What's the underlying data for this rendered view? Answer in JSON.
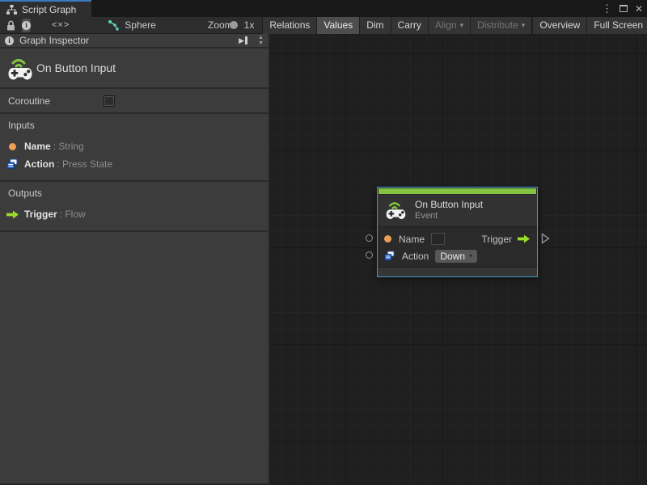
{
  "window": {
    "tab_label": "Script Graph"
  },
  "icons": {
    "menu": "⋮",
    "close": "✕",
    "code": "<×>",
    "dropdown": "▾",
    "caret": "▾",
    "spin_up": "▲",
    "spin_down": "▼",
    "info": "i",
    "dock_triangle": "▶"
  },
  "toolbar": {
    "graph_name": "Sphere",
    "zoom_label": "Zoom",
    "zoom_value": "1x",
    "buttons": [
      {
        "label": "Relations",
        "state": "normal"
      },
      {
        "label": "Values",
        "state": "active"
      },
      {
        "label": "Dim",
        "state": "normal"
      },
      {
        "label": "Carry",
        "state": "normal"
      },
      {
        "label": "Align",
        "state": "disabled",
        "dropdown": true
      },
      {
        "label": "Distribute",
        "state": "disabled",
        "dropdown": true
      },
      {
        "label": "Overview",
        "state": "normal"
      },
      {
        "label": "Full Screen",
        "state": "normal"
      }
    ]
  },
  "inspector": {
    "title": "Graph Inspector",
    "unit_title": "On Button Input",
    "coroutine_label": "Coroutine",
    "coroutine_checked": false,
    "inputs_title": "Inputs",
    "inputs": [
      {
        "name": "Name",
        "type": ": String",
        "icon": "string-port"
      },
      {
        "name": "Action",
        "type": ": Press State",
        "icon": "enum-port"
      }
    ],
    "outputs_title": "Outputs",
    "outputs": [
      {
        "name": "Trigger",
        "type": ": Flow",
        "icon": "flow-port"
      }
    ]
  },
  "node": {
    "title": "On Button Input",
    "subtitle": "Event",
    "name_port": "Name",
    "name_value": "",
    "action_port": "Action",
    "action_value": "Down",
    "trigger_port": "Trigger"
  },
  "colors": {
    "tab_accent_blue": "#3a79bb",
    "node_selection_blue": "#3f9dce",
    "event_green": "#84c342",
    "flow_arrow_green": "#9bdc28",
    "string_port_orange": "#ec9e56",
    "graph_ref_teal": "#5fd7bf"
  }
}
